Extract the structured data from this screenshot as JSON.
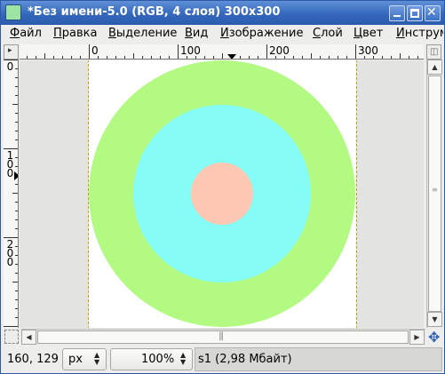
{
  "window": {
    "title": "*Без имени-5.0 (RGB, 4 слоя) 300x300"
  },
  "menu": {
    "items": [
      {
        "label": "Файл",
        "mnemonic": "Ф",
        "rest": "айл"
      },
      {
        "label": "Правка",
        "mnemonic": "П",
        "rest": "равка"
      },
      {
        "label": "Выделение",
        "mnemonic": "В",
        "rest": "ыделение"
      },
      {
        "label": "Вид",
        "mnemonic": "В",
        "rest": "ид"
      },
      {
        "label": "Изображение",
        "mnemonic": "И",
        "rest": "зображение"
      },
      {
        "label": "Слой",
        "mnemonic": "С",
        "rest": "лой"
      },
      {
        "label": "Цвет",
        "mnemonic": "Ц",
        "rest": "вет"
      },
      {
        "label": "Инструм",
        "mnemonic": "И",
        "rest": "нструм"
      }
    ]
  },
  "rulers": {
    "horizontal_labels": [
      "0",
      "100",
      "200",
      "300"
    ],
    "vertical_labels": [
      {
        "digits": [
          "0"
        ]
      },
      {
        "digits": [
          "1",
          "0",
          "0"
        ]
      },
      {
        "digits": [
          "2",
          "0",
          "0"
        ]
      }
    ]
  },
  "image": {
    "width": 300,
    "height": 300,
    "background": "#ffffff",
    "circles": [
      {
        "name": "outer-ring",
        "color": "#b3fa82",
        "radius": 150
      },
      {
        "name": "middle-ring",
        "color": "#85fcf6",
        "radius": 100
      },
      {
        "name": "inner-disc",
        "color": "#fdc8b3",
        "radius": 35
      }
    ]
  },
  "statusbar": {
    "coords": "160, 129",
    "unit": "px",
    "zoom": "100%",
    "message": "s1 (2,98 Мбайт)"
  },
  "colors": {
    "titlebar": "#3468bd",
    "selection_border": "#c8a400"
  }
}
